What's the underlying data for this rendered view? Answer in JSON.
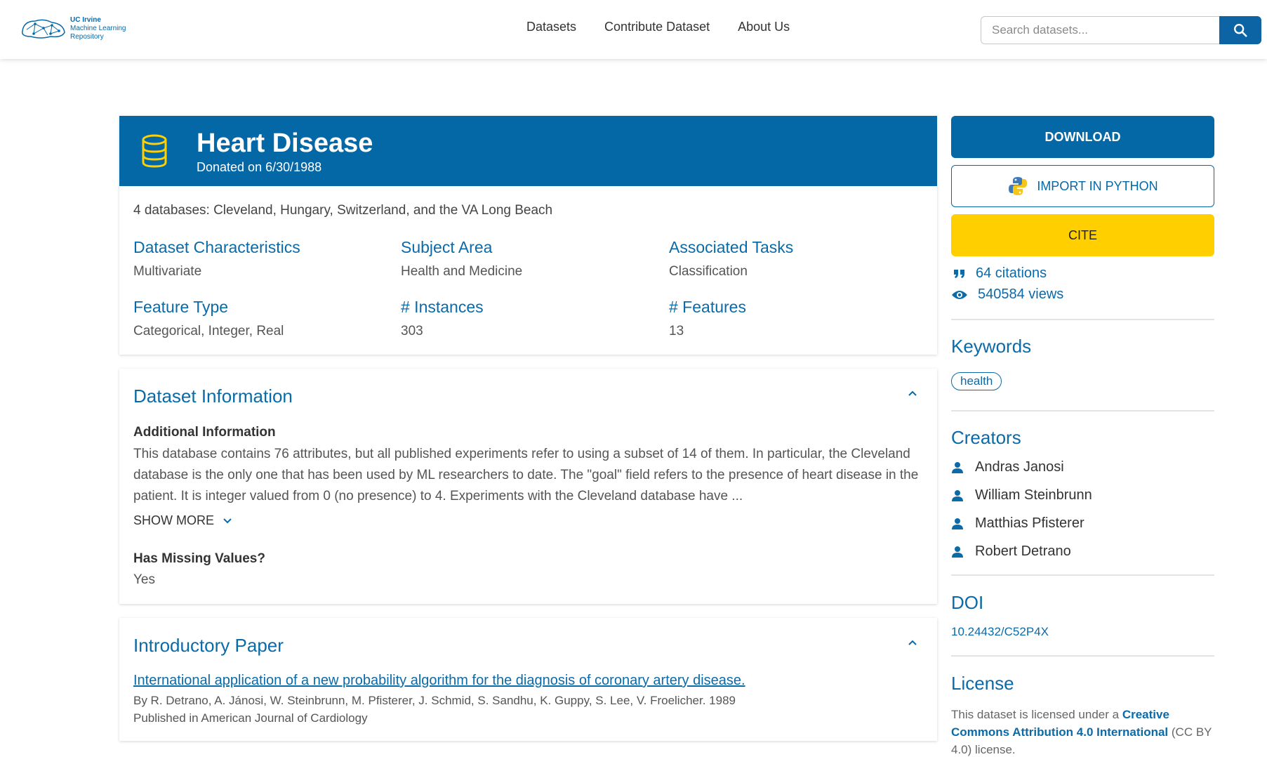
{
  "header": {
    "logo_line1": "UC Irvine",
    "logo_line2": "Machine Learning",
    "logo_line3": "Repository",
    "nav": [
      "Datasets",
      "Contribute Dataset",
      "About Us"
    ],
    "search_placeholder": "Search datasets..."
  },
  "dataset": {
    "title": "Heart Disease",
    "donated": "Donated on 6/30/1988",
    "subtitle": "4 databases: Cleveland, Hungary, Switzerland, and the VA Long Beach",
    "characteristics": [
      {
        "label": "Dataset Characteristics",
        "value": "Multivariate"
      },
      {
        "label": "Subject Area",
        "value": "Health and Medicine"
      },
      {
        "label": "Associated Tasks",
        "value": "Classification"
      },
      {
        "label": "Feature Type",
        "value": "Categorical, Integer, Real"
      },
      {
        "label": "# Instances",
        "value": "303"
      },
      {
        "label": "# Features",
        "value": "13"
      }
    ]
  },
  "info": {
    "title": "Dataset Information",
    "additional_heading": "Additional Information",
    "additional_text": "This database contains 76 attributes, but all published experiments refer to using a subset of 14 of them.  In particular, the Cleveland database is the only one that has been used by ML researchers to date.  The \"goal\" field refers to the presence of heart disease in the patient.  It is integer valued from 0 (no presence) to 4. Experiments with the Cleveland database have ...",
    "show_more": "SHOW MORE",
    "missing_heading": "Has Missing Values?",
    "missing_value": "Yes"
  },
  "paper": {
    "title": "Introductory Paper",
    "link": "International application of a new probability algorithm for the diagnosis of coronary artery disease.",
    "authors": "By R. Detrano, A. Jánosi, W. Steinbrunn, M. Pfisterer, J. Schmid, S. Sandhu, K. Guppy, S. Lee, V. Froelicher. 1989",
    "published": "Published in American Journal of Cardiology"
  },
  "sidebar": {
    "download": "DOWNLOAD",
    "import_python": "IMPORT IN PYTHON",
    "cite": "CITE",
    "citations": "64 citations",
    "views": "540584 views",
    "keywords_title": "Keywords",
    "keywords": [
      "health"
    ],
    "creators_title": "Creators",
    "creators": [
      "Andras Janosi",
      "William Steinbrunn",
      "Matthias Pfisterer",
      "Robert Detrano"
    ],
    "doi_title": "DOI",
    "doi": "10.24432/C52P4X",
    "license_title": "License",
    "license_prefix": "This dataset is licensed under a ",
    "license_link": "Creative Commons Attribution 4.0 International",
    "license_suffix": " (CC BY 4.0) license."
  },
  "colors": {
    "primary": "#0468a7",
    "cite_yellow": "#ffcf00",
    "link_blue": "#0b6aa8"
  }
}
